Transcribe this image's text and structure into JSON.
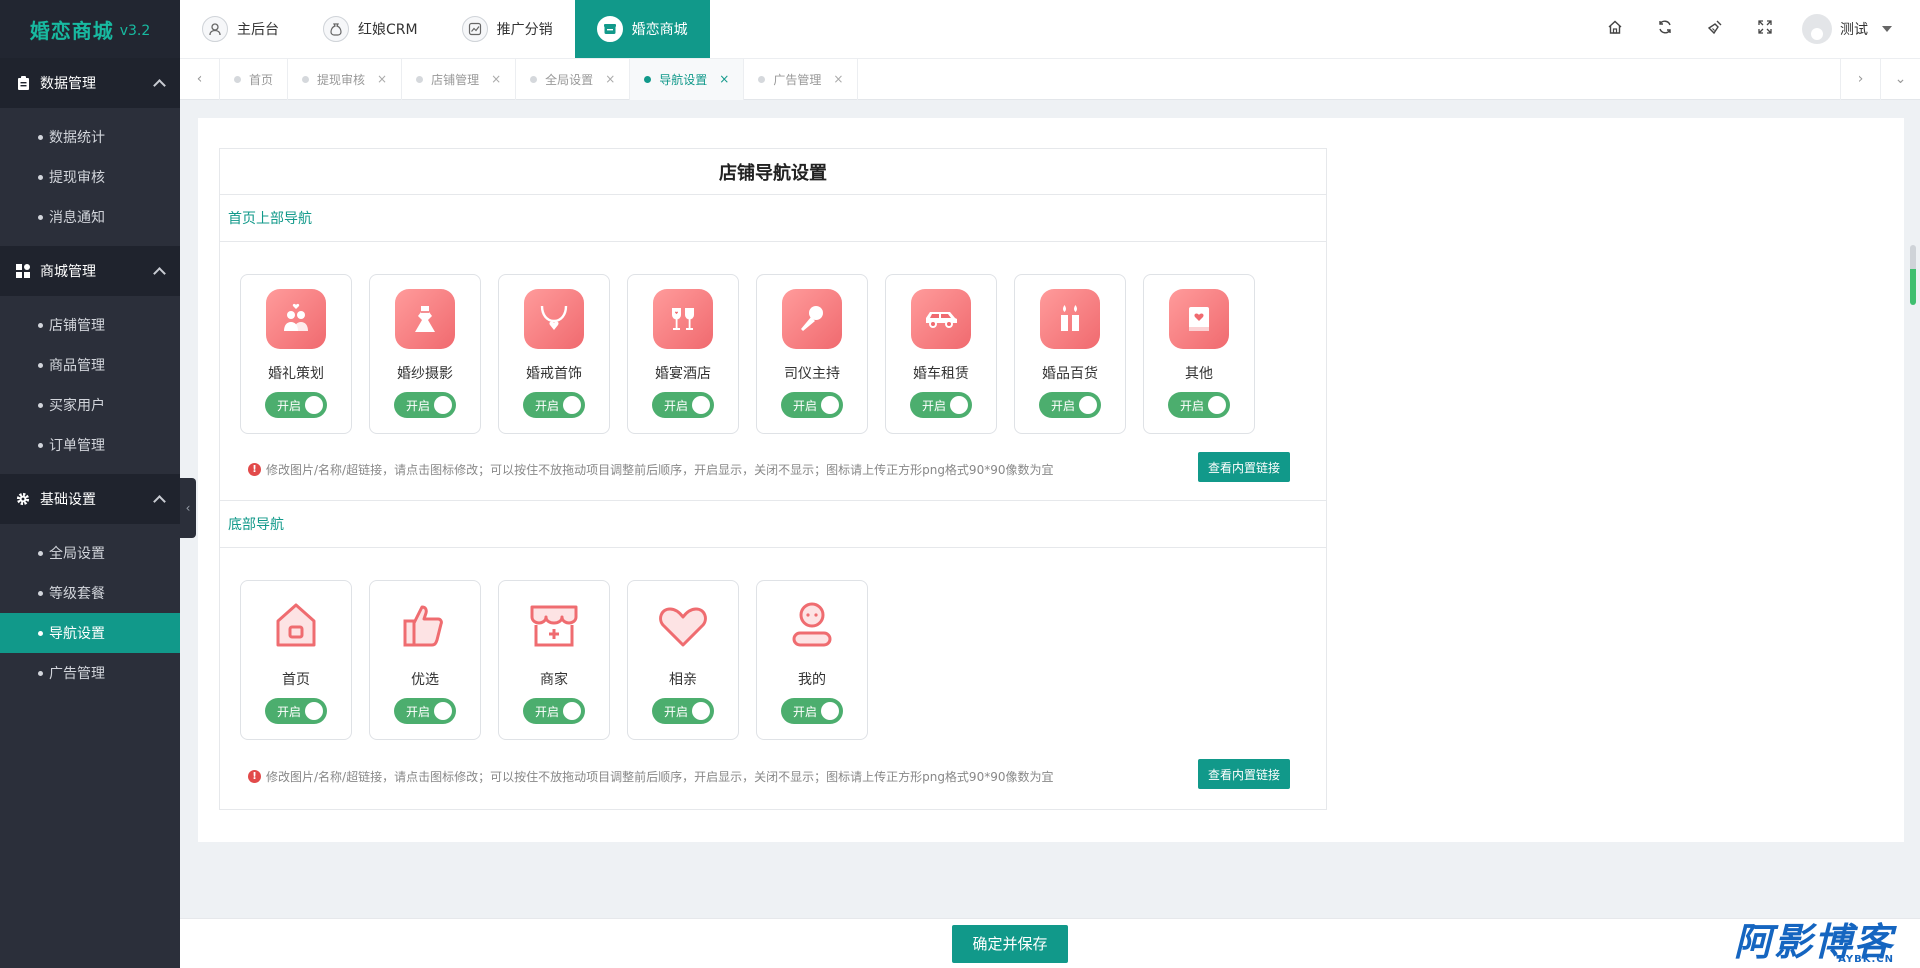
{
  "app": {
    "brand": "婚恋商城",
    "version": "v3.2"
  },
  "sidebar": {
    "groups": [
      {
        "title": "数据管理",
        "icon": "clipboard-icon",
        "items": [
          {
            "label": "数据统计"
          },
          {
            "label": "提现审核"
          },
          {
            "label": "消息通知"
          }
        ]
      },
      {
        "title": "商城管理",
        "icon": "shop-icon",
        "items": [
          {
            "label": "店铺管理"
          },
          {
            "label": "商品管理"
          },
          {
            "label": "买家用户"
          },
          {
            "label": "订单管理"
          }
        ]
      },
      {
        "title": "基础设置",
        "icon": "gear-icon",
        "items": [
          {
            "label": "全局设置"
          },
          {
            "label": "等级套餐"
          },
          {
            "label": "导航设置",
            "active": true
          },
          {
            "label": "广告管理"
          }
        ]
      }
    ]
  },
  "header": {
    "modules": [
      {
        "label": "主后台",
        "icon": "user-icon"
      },
      {
        "label": "红娘CRM",
        "icon": "money-bag-icon"
      },
      {
        "label": "推广分销",
        "icon": "trend-icon"
      },
      {
        "label": "婚恋商城",
        "icon": "store-icon",
        "active": true
      }
    ],
    "user_name": "测试"
  },
  "tabs": [
    {
      "label": "首页",
      "closable": false
    },
    {
      "label": "提现审核",
      "closable": true
    },
    {
      "label": "店铺管理",
      "closable": true
    },
    {
      "label": "全局设置",
      "closable": true
    },
    {
      "label": "导航设置",
      "closable": true,
      "active": true
    },
    {
      "label": "广告管理",
      "closable": true
    }
  ],
  "page": {
    "title": "店铺导航设置",
    "top_nav": {
      "label": "首页上部导航",
      "items": [
        {
          "name": "婚礼策划",
          "icon": "couple-icon",
          "toggle": "开启"
        },
        {
          "name": "婚纱摄影",
          "icon": "dress-icon",
          "toggle": "开启"
        },
        {
          "name": "婚戒首饰",
          "icon": "necklace-icon",
          "toggle": "开启"
        },
        {
          "name": "婚宴酒店",
          "icon": "wine-glasses-icon",
          "toggle": "开启"
        },
        {
          "name": "司仪主持",
          "icon": "microphone-icon",
          "toggle": "开启"
        },
        {
          "name": "婚车租赁",
          "icon": "car-icon",
          "toggle": "开启"
        },
        {
          "name": "婚品百货",
          "icon": "candles-icon",
          "toggle": "开启"
        },
        {
          "name": "其他",
          "icon": "book-heart-icon",
          "toggle": "开启"
        }
      ],
      "tip": "修改图片/名称/超链接，请点击图标修改；可以按住不放拖动项目调整前后顺序，开启显示，关闭不显示；图标请上传正方形png格式90*90像数为宜",
      "link_button": "查看内置链接"
    },
    "bottom_nav": {
      "label": "底部导航",
      "items": [
        {
          "name": "首页",
          "icon": "home-icon",
          "toggle": "开启"
        },
        {
          "name": "优选",
          "icon": "thumbs-up-icon",
          "toggle": "开启"
        },
        {
          "name": "商家",
          "icon": "shop-awning-icon",
          "toggle": "开启"
        },
        {
          "name": "相亲",
          "icon": "heart-icon",
          "toggle": "开启"
        },
        {
          "name": "我的",
          "icon": "profile-icon",
          "toggle": "开启"
        }
      ],
      "tip": "修改图片/名称/超链接，请点击图标修改；可以按住不放拖动项目调整前后顺序，开启显示，关闭不显示；图标请上传正方形png格式90*90像数为宜",
      "link_button": "查看内置链接"
    },
    "save_button": "确定并保存"
  },
  "watermark": {
    "main": "阿影博客",
    "sub": "AYBK.CN"
  },
  "colors": {
    "accent": "#11998a",
    "sidebar_bg": "#2b2f3a",
    "toggle_on": "#4cae6e",
    "icon_pink": "#f06a6f"
  }
}
